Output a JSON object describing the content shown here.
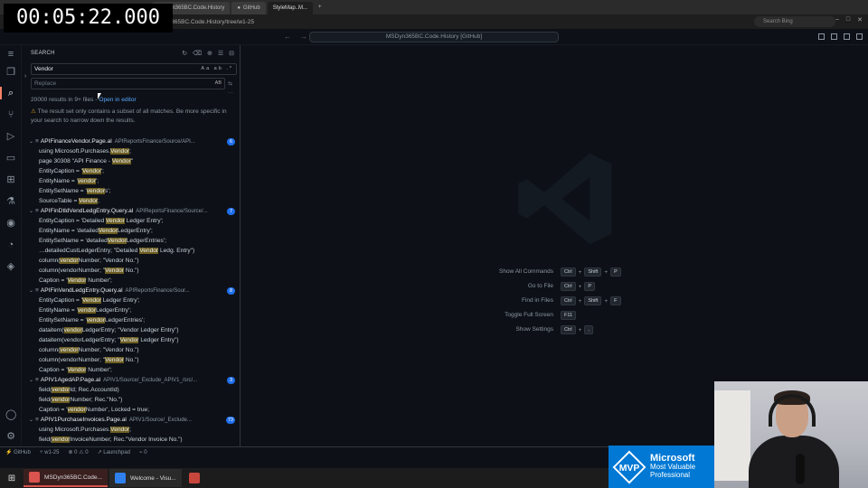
{
  "timer": "00:05:22.000",
  "browser": {
    "tabs": [
      "MSDyn365BC.Code.History",
      "GitHub",
      "StyleMap..M..."
    ],
    "url": "MSDyn365BC.Code.History/tree/w1-25",
    "search_placeholder": "Search Bing"
  },
  "vscode": {
    "command_center": "MSDyn365BC.Code.History [GitHub]",
    "sidebar_title": "SEARCH",
    "search_value": "Vendor",
    "search_opts": "Aa ab .*",
    "replace_placeholder": "Replace",
    "replace_opt": "AB",
    "summary_text": "20000 results in 9+ files - ",
    "open_in_editor": "Open in editor",
    "warning": "The result set only contains a subset of all matches. Be more specific in your search to narrow down the results.",
    "files": [
      {
        "name": "APIFinanceVendor.Page.al",
        "path": "APIReportsFinance/Source/API...",
        "count": "6",
        "lines": [
          {
            "pre": "using Microsoft.Purchases.",
            "hl": "Vendor",
            "post": ";"
          },
          {
            "pre": "page 30308 \"API Finance - ",
            "hl": "Vendor",
            "post": "\""
          },
          {
            "pre": "EntityCaption = '",
            "hl": "Vendor",
            "post": "';"
          },
          {
            "pre": "EntityName = '",
            "hl": "vendor",
            "post": "';"
          },
          {
            "pre": "EntitySetName = '",
            "hl": "vendor",
            "post": "s';"
          },
          {
            "pre": "SourceTable = ",
            "hl": "Vendor",
            "post": ";"
          }
        ]
      },
      {
        "name": "APIFinDtldVendLedgEntry.Query.al",
        "path": "APIReportsFinance/Source/...",
        "count": "7",
        "lines": [
          {
            "pre": "EntityCaption = 'Detailed ",
            "hl": "Vendor",
            "post": " Ledger Entry';"
          },
          {
            "pre": "EntityName = 'detailed",
            "hl": "Vendor",
            "post": "LedgerEntry';"
          },
          {
            "pre": "EntitySetName = 'detailed",
            "hl": "Vendor",
            "post": "LedgerEntries';"
          },
          {
            "pre": "…detailedCustLedgerEntry; \"Detailed ",
            "hl": "Vendor",
            "post": " Ledg. Entry\")"
          },
          {
            "pre": "column(",
            "hl": "vendor",
            "post": "Number; \"Vendor No.\")"
          },
          {
            "pre": "column(vendorNumber; \"",
            "hl": "Vendor",
            "post": " No.\")"
          },
          {
            "pre": "Caption = '",
            "hl": "Vendor",
            "post": " Number';"
          }
        ]
      },
      {
        "name": "APIFinVendLedgEntry.Query.al",
        "path": "APIReportsFinance/Sour...",
        "count": "8",
        "lines": [
          {
            "pre": "EntityCaption = '",
            "hl": "Vendor",
            "post": " Ledger Entry';"
          },
          {
            "pre": "EntityName = '",
            "hl": "vendor",
            "post": "LedgerEntry';"
          },
          {
            "pre": "EntitySetName = '",
            "hl": "vendor",
            "post": "LedgerEntries';"
          },
          {
            "pre": "dataitem(",
            "hl": "vendor",
            "post": "LedgerEntry; \"Vendor Ledger Entry\")"
          },
          {
            "pre": "dataitem(vendorLedgerEntry; \"",
            "hl": "Vendor",
            "post": " Ledger Entry\")"
          },
          {
            "pre": "column(",
            "hl": "vendor",
            "post": "Number; \"Vendor No.\")"
          },
          {
            "pre": "column(vendorNumber; \"",
            "hl": "Vendor",
            "post": " No.\")"
          },
          {
            "pre": "Caption = '",
            "hl": "Vendor",
            "post": " Number';"
          }
        ]
      },
      {
        "name": "APIV1AgedAP.Page.al",
        "path": "APIV1/Source/_Exclude_APIV1_/src/...",
        "count": "3",
        "lines": [
          {
            "pre": "field(",
            "hl": "vendor",
            "post": "Id; Rec.AccountId)"
          },
          {
            "pre": "field(",
            "hl": "vendor",
            "post": "Number; Rec.\"No.\")"
          },
          {
            "pre": "Caption = '",
            "hl": "vendor",
            "post": "Number', Locked = true;"
          }
        ]
      },
      {
        "name": "APIV1PurchaseInvoices.Page.al",
        "path": "APIV1/Source/_Exclude...",
        "count": "73",
        "lines": [
          {
            "pre": "using Microsoft.Purchases.",
            "hl": "Vendor",
            "post": ";"
          },
          {
            "pre": "field(",
            "hl": "vendor",
            "post": "InvoiceNumber; Rec.\"Vendor Invoice No.\")"
          }
        ]
      }
    ],
    "shortcuts": [
      {
        "label": "Show All Commands",
        "keys": [
          "Ctrl",
          "+",
          "Shift",
          "+",
          "P"
        ]
      },
      {
        "label": "Go to File",
        "keys": [
          "Ctrl",
          "+",
          "P"
        ]
      },
      {
        "label": "Find in Files",
        "keys": [
          "Ctrl",
          "+",
          "Shift",
          "+",
          "F"
        ]
      },
      {
        "label": "Toggle Full Screen",
        "keys": [
          "F11"
        ]
      },
      {
        "label": "Show Settings",
        "keys": [
          "Ctrl",
          "+",
          ","
        ]
      }
    ],
    "status": {
      "remote": "GitHub",
      "branch": "w1-25",
      "errors": "0",
      "warnings": "0",
      "launchpad": "Launchpad",
      "ports": "0"
    }
  },
  "taskbar": {
    "apps": [
      "MSDyn365BC.Code...",
      "Welcome - Visu..."
    ]
  },
  "mvp": {
    "line1": "Microsoft",
    "line2": "Most Valuable",
    "line3": "Professional",
    "badge": "MVP"
  },
  "colors": {
    "accent": "#1f6feb",
    "highlight": "#6d5d20",
    "mvp_blue": "#0078d4"
  }
}
